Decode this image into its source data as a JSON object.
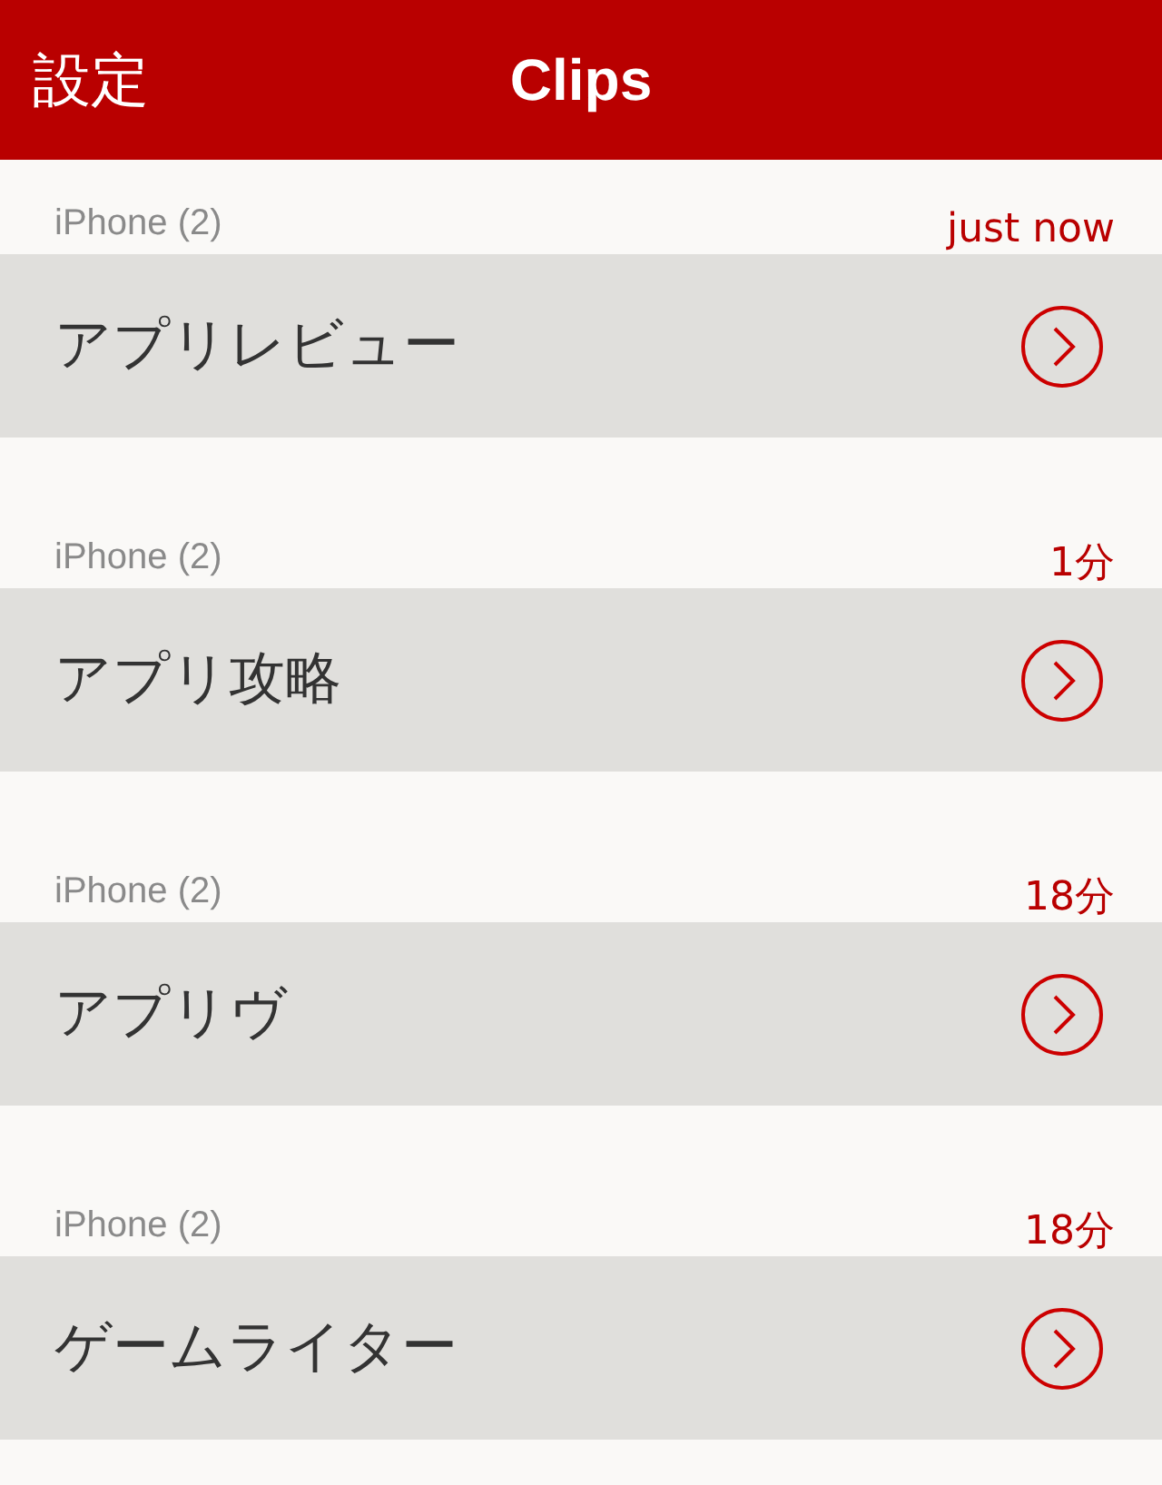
{
  "nav": {
    "back": "設定",
    "title": "Clips"
  },
  "clips": [
    {
      "device": "iPhone (2)",
      "time": "just now",
      "title": "アプリレビュー"
    },
    {
      "device": "iPhone (2)",
      "time": "1分",
      "title": "アプリ攻略"
    },
    {
      "device": "iPhone (2)",
      "time": "18分",
      "title": "アプリヴ"
    },
    {
      "device": "iPhone (2)",
      "time": "18分",
      "title": "ゲームライター"
    }
  ]
}
